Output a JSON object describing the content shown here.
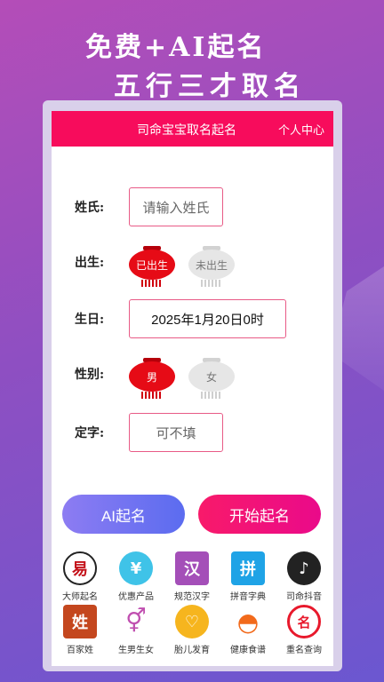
{
  "promo": {
    "line1": "免费+AI起名",
    "line2": "五行三才取名"
  },
  "topbar": {
    "title": "司命宝宝取名起名",
    "user_center": "个人中心"
  },
  "form": {
    "surname_label": "姓氏:",
    "surname_placeholder": "请输入姓氏",
    "birth_label": "出生:",
    "born_option": "已出生",
    "unborn_option": "未出生",
    "birthday_label": "生日:",
    "birthday_value": "2025年1月20日0时",
    "gender_label": "性别:",
    "male_option": "男",
    "female_option": "女",
    "fixed_char_label": "定字:",
    "fixed_char_placeholder": "可不填"
  },
  "buttons": {
    "ai_naming": "AI起名",
    "start_naming": "开始起名"
  },
  "features": [
    {
      "label": "大师起名",
      "icon": "master-seal-icon",
      "glyph": "易"
    },
    {
      "label": "优惠产品",
      "icon": "coupon-icon",
      "glyph": "¥"
    },
    {
      "label": "规范汉字",
      "icon": "chinese-char-icon",
      "glyph": "汉"
    },
    {
      "label": "拼音字典",
      "icon": "pinyin-dictionary-icon",
      "glyph": "拼"
    },
    {
      "label": "司命抖音",
      "icon": "douyin-icon",
      "glyph": "♪"
    },
    {
      "label": "百家姓",
      "icon": "surname-book-icon",
      "glyph": "姓"
    },
    {
      "label": "生男生女",
      "icon": "gender-symbol-icon",
      "glyph": "⚥"
    },
    {
      "label": "胎儿发育",
      "icon": "fetus-icon",
      "glyph": "♡"
    },
    {
      "label": "健康食谱",
      "icon": "food-cloche-icon",
      "glyph": "◓"
    },
    {
      "label": "重名查询",
      "icon": "name-search-icon",
      "glyph": "名"
    }
  ],
  "colors": {
    "accent": "#f70c5c",
    "selected": "#e60b16"
  }
}
